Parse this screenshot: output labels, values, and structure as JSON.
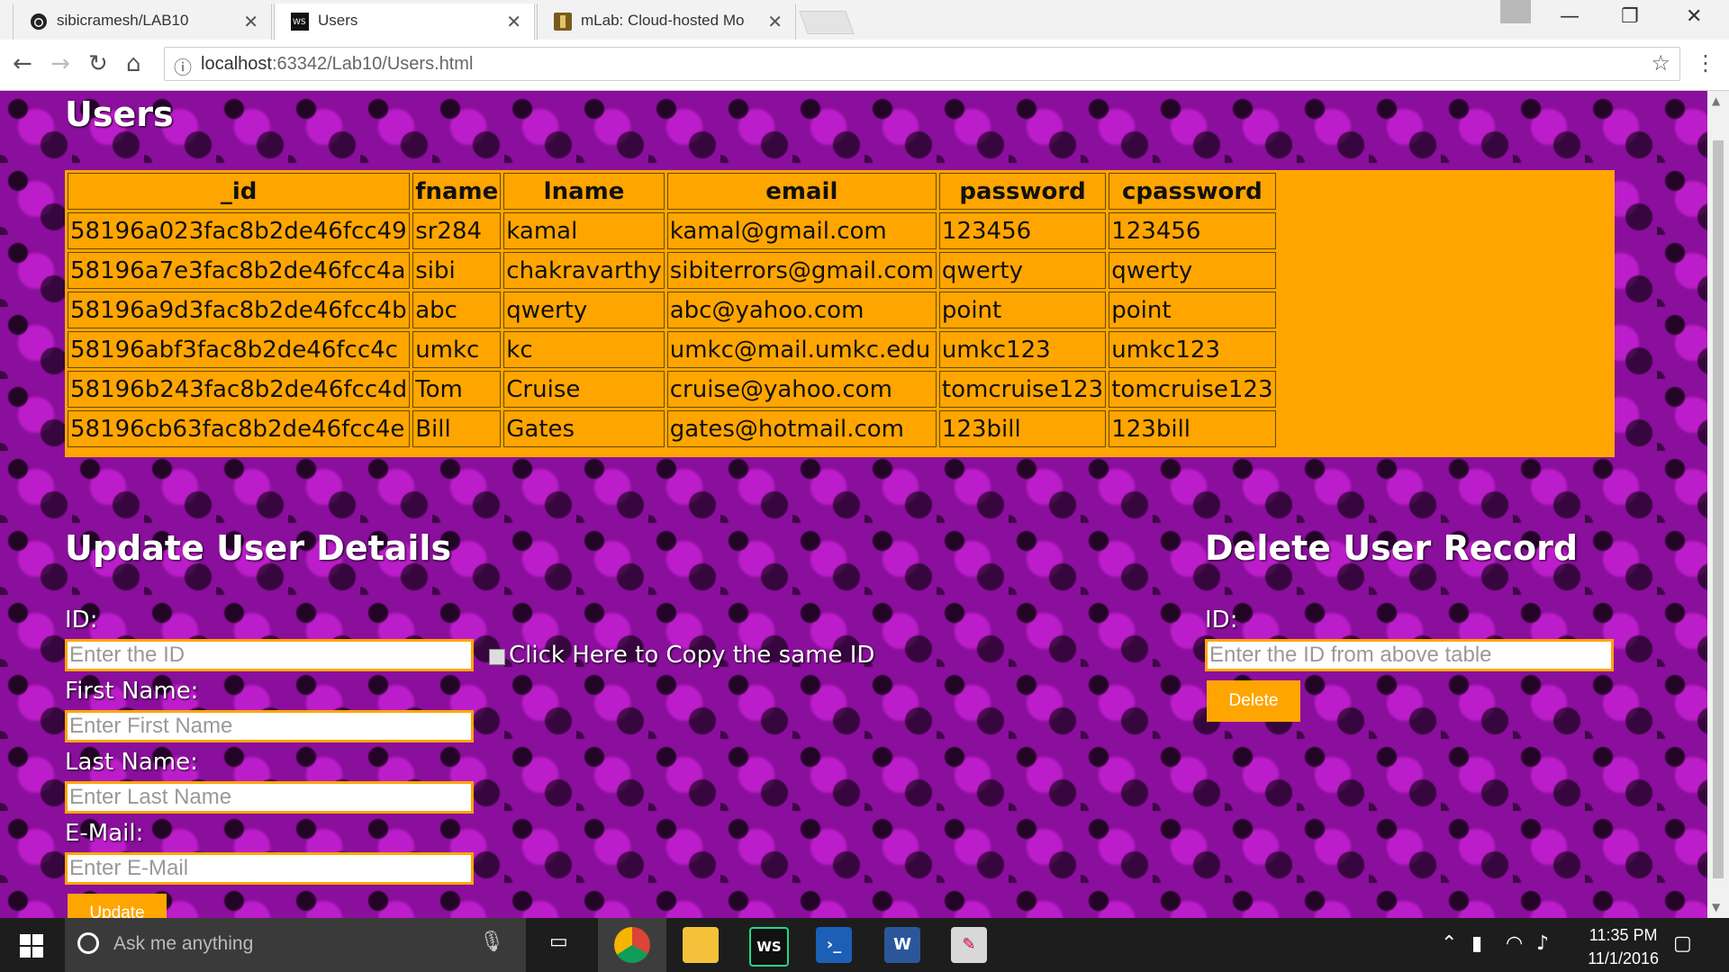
{
  "browser": {
    "tabs": [
      {
        "title": "sibicramesh/LAB10",
        "favicon": "github-icon"
      },
      {
        "title": "Users",
        "favicon": "webstorm-icon"
      },
      {
        "title": "mLab: Cloud-hosted Mo",
        "favicon": "mlab-icon"
      }
    ],
    "url_host": "localhost",
    "url_rest": ":63342/Lab10/Users.html"
  },
  "page": {
    "title": "Users",
    "table": {
      "headers": [
        "_id",
        "fname",
        "lname",
        "email",
        "password",
        "cpassword"
      ],
      "rows": [
        [
          "58196a023fac8b2de46fcc49",
          "sr284",
          "kamal",
          "kamal@gmail.com",
          "123456",
          "123456"
        ],
        [
          "58196a7e3fac8b2de46fcc4a",
          "sibi",
          "chakravarthy",
          "sibiterrors@gmail.com",
          "qwerty",
          "qwerty"
        ],
        [
          "58196a9d3fac8b2de46fcc4b",
          "abc",
          "qwerty",
          "abc@yahoo.com",
          "point",
          "point"
        ],
        [
          "58196abf3fac8b2de46fcc4c",
          "umkc",
          "kc",
          "umkc@mail.umkc.edu",
          "umkc123",
          "umkc123"
        ],
        [
          "58196b243fac8b2de46fcc4d",
          "Tom",
          "Cruise",
          "cruise@yahoo.com",
          "tomcruise123",
          "tomcruise123"
        ],
        [
          "58196cb63fac8b2de46fcc4e",
          "Bill",
          "Gates",
          "gates@hotmail.com",
          "123bill",
          "123bill"
        ]
      ]
    },
    "update": {
      "heading": "Update User Details",
      "id_label": "ID:",
      "id_placeholder": "Enter the ID",
      "copy_label": "Click Here to Copy the same ID",
      "fname_label": "First Name:",
      "fname_placeholder": "Enter First Name",
      "lname_label": "Last Name:",
      "lname_placeholder": "Enter Last Name",
      "email_label": "E-Mail:",
      "email_placeholder": "Enter E-Mail",
      "button": "Update"
    },
    "delete": {
      "heading": "Delete User Record",
      "id_label": "ID:",
      "id_placeholder": "Enter the ID from above table",
      "button": "Delete"
    }
  },
  "taskbar": {
    "search_placeholder": "Ask me anything",
    "time": "11:35 PM",
    "date": "11/1/2016"
  },
  "colors": {
    "accent": "#ffa500",
    "background": "#8a0f9c"
  }
}
